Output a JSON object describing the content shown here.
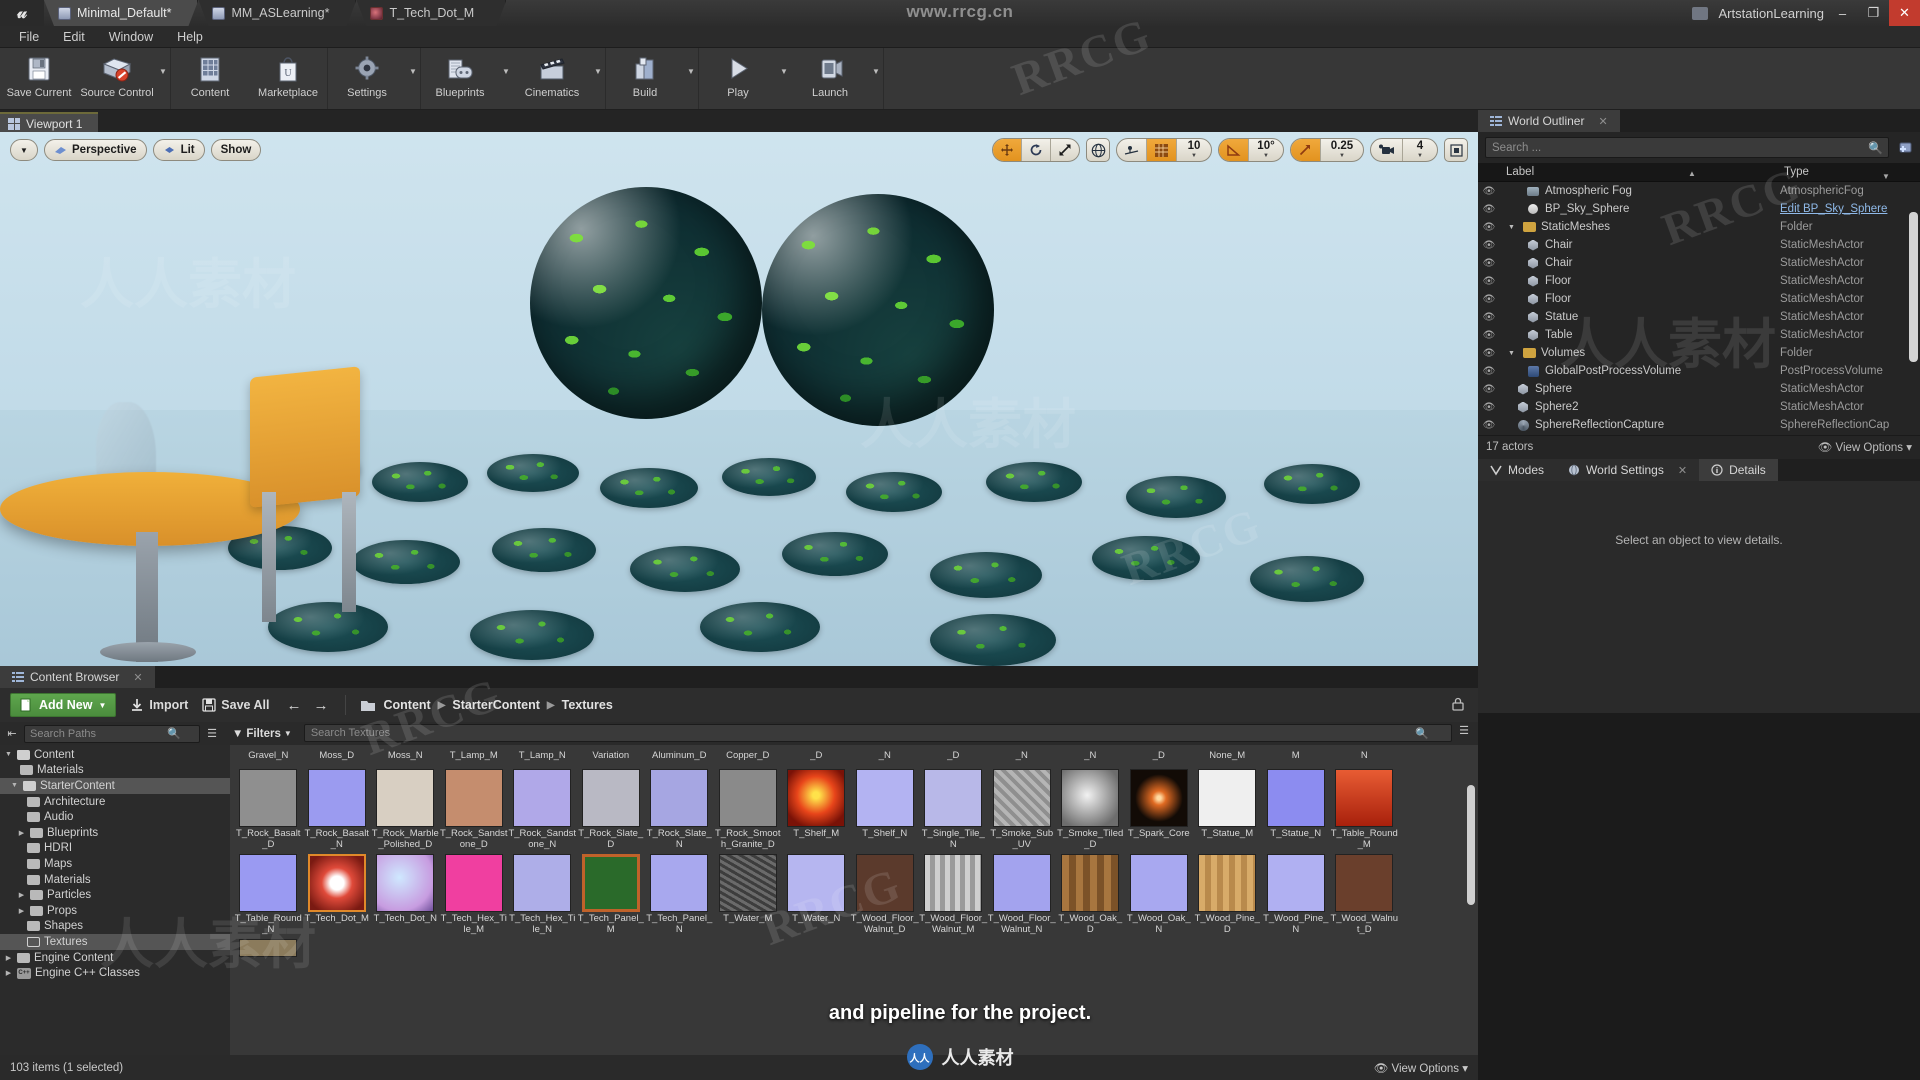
{
  "titlebar": {
    "logo": "unreal-logo",
    "tabs": [
      {
        "label": "Minimal_Default*",
        "icon": "level-icon",
        "active": true
      },
      {
        "label": "MM_ASLearning*",
        "icon": "material-icon",
        "active": false
      },
      {
        "label": "T_Tech_Dot_M",
        "icon": "texture-icon",
        "active": false
      }
    ],
    "center_text": "www.rrcg.cn",
    "account": "ArtstationLearning",
    "window_buttons": [
      "minimize",
      "maximize",
      "close"
    ]
  },
  "menubar": {
    "items": [
      "File",
      "Edit",
      "Window",
      "Help"
    ]
  },
  "toolbar": {
    "groups": [
      {
        "buttons": [
          {
            "label": "Save Current",
            "icon": "save-icon",
            "caret": false
          },
          {
            "label": "Source Control",
            "icon": "source-control-icon",
            "caret": true
          }
        ]
      },
      {
        "buttons": [
          {
            "label": "Content",
            "icon": "content-icon",
            "caret": false
          },
          {
            "label": "Marketplace",
            "icon": "marketplace-icon",
            "caret": false
          }
        ]
      },
      {
        "buttons": [
          {
            "label": "Settings",
            "icon": "settings-icon",
            "caret": true
          }
        ]
      },
      {
        "buttons": [
          {
            "label": "Blueprints",
            "icon": "blueprints-icon",
            "caret": true
          },
          {
            "label": "Cinematics",
            "icon": "cinematics-icon",
            "caret": true
          }
        ]
      },
      {
        "buttons": [
          {
            "label": "Build",
            "icon": "build-icon",
            "caret": true
          }
        ]
      },
      {
        "buttons": [
          {
            "label": "Play",
            "icon": "play-icon",
            "caret": true
          },
          {
            "label": "Launch",
            "icon": "launch-icon",
            "caret": true
          }
        ]
      }
    ]
  },
  "viewport": {
    "tab_label": "Viewport 1",
    "left_controls": {
      "view_menu": "view-menu-caret",
      "perspective": "Perspective",
      "lit": "Lit",
      "show": "Show"
    },
    "right_controls": {
      "transform_modes": [
        "translate",
        "rotate",
        "scale"
      ],
      "coordinate_system": "world",
      "surface_snap": "surface-snapping",
      "grid_snap_on": true,
      "grid_snap_value": "10",
      "angle_snap_on": true,
      "angle_snap_value": "10°",
      "scale_snap_on": true,
      "scale_snap_value": "0.25",
      "camera_speed": "4",
      "maximize": "maximize-viewport"
    }
  },
  "outliner": {
    "tab_label": "World Outliner",
    "search_placeholder": "Search ...",
    "columns": [
      "Label",
      "Type"
    ],
    "rows": [
      {
        "label": "Atmospheric Fog",
        "type": "AtmosphericFog",
        "icon": "fog-icon",
        "indent": 1,
        "expander": false,
        "link": false
      },
      {
        "label": "BP_Sky_Sphere",
        "type": "Edit BP_Sky_Sphere",
        "icon": "sphere-icon",
        "indent": 1,
        "expander": false,
        "link": true
      },
      {
        "label": "StaticMeshes",
        "type": "Folder",
        "icon": "folder-icon",
        "indent": 0,
        "expander": true,
        "link": false
      },
      {
        "label": "Chair",
        "type": "StaticMeshActor",
        "icon": "mesh-icon",
        "indent": 1,
        "expander": false,
        "link": false
      },
      {
        "label": "Chair",
        "type": "StaticMeshActor",
        "icon": "mesh-icon",
        "indent": 1,
        "expander": false,
        "link": false
      },
      {
        "label": "Floor",
        "type": "StaticMeshActor",
        "icon": "mesh-icon",
        "indent": 1,
        "expander": false,
        "link": false
      },
      {
        "label": "Floor",
        "type": "StaticMeshActor",
        "icon": "mesh-icon",
        "indent": 1,
        "expander": false,
        "link": false
      },
      {
        "label": "Statue",
        "type": "StaticMeshActor",
        "icon": "mesh-icon",
        "indent": 1,
        "expander": false,
        "link": false
      },
      {
        "label": "Table",
        "type": "StaticMeshActor",
        "icon": "mesh-icon",
        "indent": 1,
        "expander": false,
        "link": false
      },
      {
        "label": "Volumes",
        "type": "Folder",
        "icon": "folder-icon",
        "indent": 0,
        "expander": true,
        "link": false
      },
      {
        "label": "GlobalPostProcessVolume",
        "type": "PostProcessVolume",
        "icon": "volume-icon",
        "indent": 1,
        "expander": false,
        "link": false
      },
      {
        "label": "Sphere",
        "type": "StaticMeshActor",
        "icon": "mesh-icon",
        "indent": 0,
        "expander": false,
        "link": false
      },
      {
        "label": "Sphere2",
        "type": "StaticMeshActor",
        "icon": "mesh-icon",
        "indent": 0,
        "expander": false,
        "link": false
      },
      {
        "label": "SphereReflectionCapture",
        "type": "SphereReflectionCap",
        "icon": "reflection-icon",
        "indent": 0,
        "expander": false,
        "link": false
      }
    ],
    "footer_count": "17 actors",
    "footer_view_options": "View Options"
  },
  "details": {
    "tabs": [
      {
        "label": "Modes",
        "icon": "modes-icon",
        "active": false
      },
      {
        "label": "World Settings",
        "icon": "world-settings-icon",
        "active": false
      },
      {
        "label": "Details",
        "icon": "details-icon",
        "active": true
      }
    ],
    "empty_message": "Select an object to view details."
  },
  "content_browser": {
    "tab_label": "Content Browser",
    "add_new_label": "Add New",
    "import_label": "Import",
    "save_all_label": "Save All",
    "back_arrow": "back-arrow",
    "forward_arrow": "forward-arrow",
    "breadcrumb": [
      "Content",
      "StarterContent",
      "Textures"
    ],
    "lock_icon": "lock-icon",
    "paths_search_placeholder": "Search Paths",
    "filters_label": "Filters",
    "asset_search_placeholder": "Search Textures",
    "tree": [
      {
        "label": "Content",
        "depth": 0,
        "expander": "open",
        "folder": "open",
        "selected": false
      },
      {
        "label": "Materials",
        "depth": 1,
        "expander": "none",
        "folder": "closed",
        "selected": false
      },
      {
        "label": "StarterContent",
        "depth": 1,
        "expander": "open",
        "folder": "open",
        "selected": true
      },
      {
        "label": "Architecture",
        "depth": 2,
        "expander": "none",
        "folder": "closed",
        "selected": false
      },
      {
        "label": "Audio",
        "depth": 2,
        "expander": "none",
        "folder": "closed",
        "selected": false
      },
      {
        "label": "Blueprints",
        "depth": 2,
        "expander": "closed",
        "folder": "closed",
        "selected": false
      },
      {
        "label": "HDRI",
        "depth": 2,
        "expander": "none",
        "folder": "closed",
        "selected": false
      },
      {
        "label": "Maps",
        "depth": 2,
        "expander": "none",
        "folder": "closed",
        "selected": false
      },
      {
        "label": "Materials",
        "depth": 2,
        "expander": "none",
        "folder": "closed",
        "selected": false
      },
      {
        "label": "Particles",
        "depth": 2,
        "expander": "closed",
        "folder": "closed",
        "selected": false
      },
      {
        "label": "Props",
        "depth": 2,
        "expander": "closed",
        "folder": "closed",
        "selected": false
      },
      {
        "label": "Shapes",
        "depth": 2,
        "expander": "none",
        "folder": "closed",
        "selected": false
      },
      {
        "label": "Textures",
        "depth": 2,
        "expander": "none",
        "folder": "outline",
        "selected": true
      },
      {
        "label": "Engine Content",
        "depth": 0,
        "expander": "closed",
        "folder": "closed",
        "selected": false
      },
      {
        "label": "Engine C++ Classes",
        "depth": 0,
        "expander": "closed",
        "folder": "cpp",
        "selected": false
      }
    ],
    "clipped_top_row": [
      "Gravel_N",
      "Moss_D",
      "Moss_N",
      "T_Lamp_M",
      "T_Lamp_N",
      "Variation",
      "Aluminum_D",
      "Copper_D",
      "_D",
      "_N",
      "_D",
      "_N",
      "_N",
      "_D",
      "None_M",
      "M",
      "N"
    ],
    "assets_row1": [
      {
        "name": "T_Rock_Basalt_D",
        "swatch": "#8f8f8f",
        "selected": false
      },
      {
        "name": "T_Rock_Basalt_N",
        "swatch": "#9b9bf0",
        "selected": false
      },
      {
        "name": "T_Rock_Marble_Polished_D",
        "swatch": "#d8cfc2",
        "selected": false
      },
      {
        "name": "T_Rock_Sandstone_D",
        "swatch": "#c58d6e",
        "selected": false
      },
      {
        "name": "T_Rock_Sandstone_N",
        "swatch": "#b0a8e8",
        "selected": false
      },
      {
        "name": "T_Rock_Slate_D",
        "swatch": "#b9b9c4",
        "selected": false
      },
      {
        "name": "T_Rock_Slate_N",
        "swatch": "#a6a6e2",
        "selected": false
      },
      {
        "name": "T_Rock_Smooth_Granite_D",
        "swatch": "#8a8a8a",
        "selected": false
      },
      {
        "name": "T_Shelf_M",
        "swatch": "#d33a12",
        "selected": false
      },
      {
        "name": "T_Shelf_N",
        "swatch": "#b3b3f2",
        "selected": false
      },
      {
        "name": "T_Single_Tile_N",
        "swatch": "#b8b8e8",
        "selected": false
      },
      {
        "name": "T_Smoke_Sub_UV",
        "swatch": "#9a9a9a",
        "selected": false
      },
      {
        "name": "T_Smoke_Tiled_D",
        "swatch": "#cccccc",
        "selected": false
      },
      {
        "name": "T_Spark_Core",
        "swatch": "#120b06",
        "selected": false
      },
      {
        "name": "T_Statue_M",
        "swatch": "#efefef",
        "selected": false
      },
      {
        "name": "T_Statue_N",
        "swatch": "#8c8cf0",
        "selected": false
      },
      {
        "name": "T_Table_Round_M",
        "swatch": "#cf3a22",
        "selected": false
      }
    ],
    "assets_row2": [
      {
        "name": "T_Table_Round_N",
        "swatch": "#9a9af2",
        "selected": false
      },
      {
        "name": "T_Tech_Dot_M",
        "swatch": "#e04a3a",
        "selected": true
      },
      {
        "name": "T_Tech_Dot_N",
        "swatch": "#cfa7e0",
        "selected": false
      },
      {
        "name": "T_Tech_Hex_Tile_M",
        "swatch": "#f03fa0",
        "selected": false
      },
      {
        "name": "T_Tech_Hex_Tile_N",
        "swatch": "#aeaee8",
        "selected": false
      },
      {
        "name": "T_Tech_Panel_M",
        "swatch": "#2a6a2a",
        "selected": false
      },
      {
        "name": "T_Tech_Panel_N",
        "swatch": "#a8a8ee",
        "selected": false
      },
      {
        "name": "T_Water_M",
        "swatch": "#555555",
        "selected": false
      },
      {
        "name": "T_Water_N",
        "swatch": "#b6b6f0",
        "selected": false
      },
      {
        "name": "T_Wood_Floor_Walnut_D",
        "swatch": "#5b3a2c",
        "selected": false
      },
      {
        "name": "T_Wood_Floor_Walnut_M",
        "swatch": "#b9b9b9",
        "selected": false
      },
      {
        "name": "T_Wood_Floor_Walnut_N",
        "swatch": "#a3a3ee",
        "selected": false
      },
      {
        "name": "T_Wood_Oak_D",
        "swatch": "#9a6a39",
        "selected": false
      },
      {
        "name": "T_Wood_Oak_N",
        "swatch": "#a8a8f0",
        "selected": false
      },
      {
        "name": "T_Wood_Pine_D",
        "swatch": "#c79a5c",
        "selected": false
      },
      {
        "name": "T_Wood_Pine_N",
        "swatch": "#b0b0f2",
        "selected": false
      },
      {
        "name": "T_Wood_Walnut_D",
        "swatch": "#6a3f2c",
        "selected": false
      }
    ],
    "footer_status": "103 items (1 selected)",
    "footer_view_options": "View Options"
  },
  "overlay": {
    "caption": "and pipeline for the project.",
    "brand_text": "人人素材",
    "brand_mark": "人人"
  },
  "watermarks": {
    "rrcg": "RRCG",
    "cn": "人人素材"
  },
  "colors": {
    "accent_orange": "#e2931f",
    "add_new_green": "#5ea64d",
    "link_blue": "#8fb9e8",
    "selection": "#555555"
  }
}
